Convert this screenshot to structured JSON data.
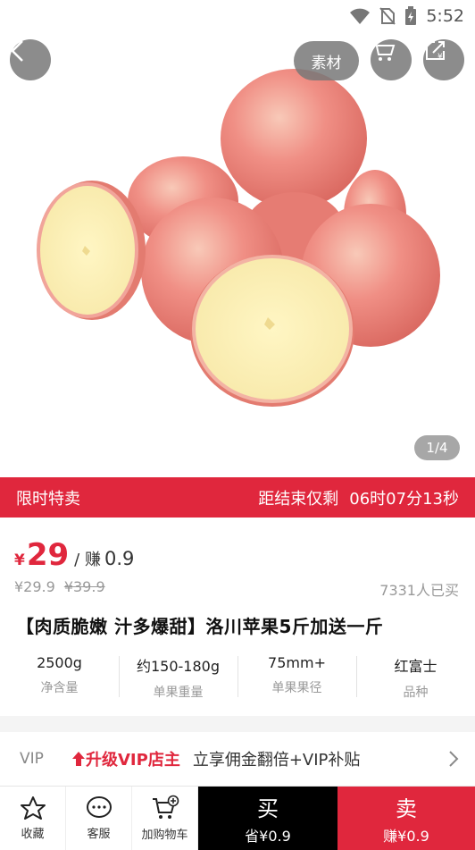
{
  "status": {
    "time": "5:52"
  },
  "header": {
    "material_label": "素材"
  },
  "gallery": {
    "indicator": "1/4"
  },
  "flash": {
    "title": "限时特卖",
    "countdown_label": "距结束仅剩",
    "countdown": "06时07分13秒"
  },
  "price": {
    "currency": "¥",
    "current": "29",
    "earn_label": "/ 赚",
    "earn_value": "0.9",
    "member_price": "¥29.9",
    "original_price": "¥39.9",
    "sold": "7331人已买"
  },
  "product": {
    "title": "【肉质脆嫩 汁多爆甜】洛川苹果5斤加送一斤"
  },
  "specs": [
    {
      "value": "2500g",
      "label": "净含量"
    },
    {
      "value": "约150-180g",
      "label": "单果重量"
    },
    {
      "value": "75mm+",
      "label": "单果果径"
    },
    {
      "value": "红富士",
      "label": "品种"
    }
  ],
  "vip": {
    "tag": "VIP",
    "upgrade": "升级VIP店主",
    "desc": "立享佣金翻倍+VIP补贴"
  },
  "bottom": {
    "favorite": "收藏",
    "service": "客服",
    "add_cart": "加购物车",
    "buy": "买",
    "buy_sub": "省¥0.9",
    "sell": "卖",
    "sell_sub": "赚¥0.9"
  },
  "colors": {
    "accent": "#e0273d",
    "dark": "#000000"
  }
}
